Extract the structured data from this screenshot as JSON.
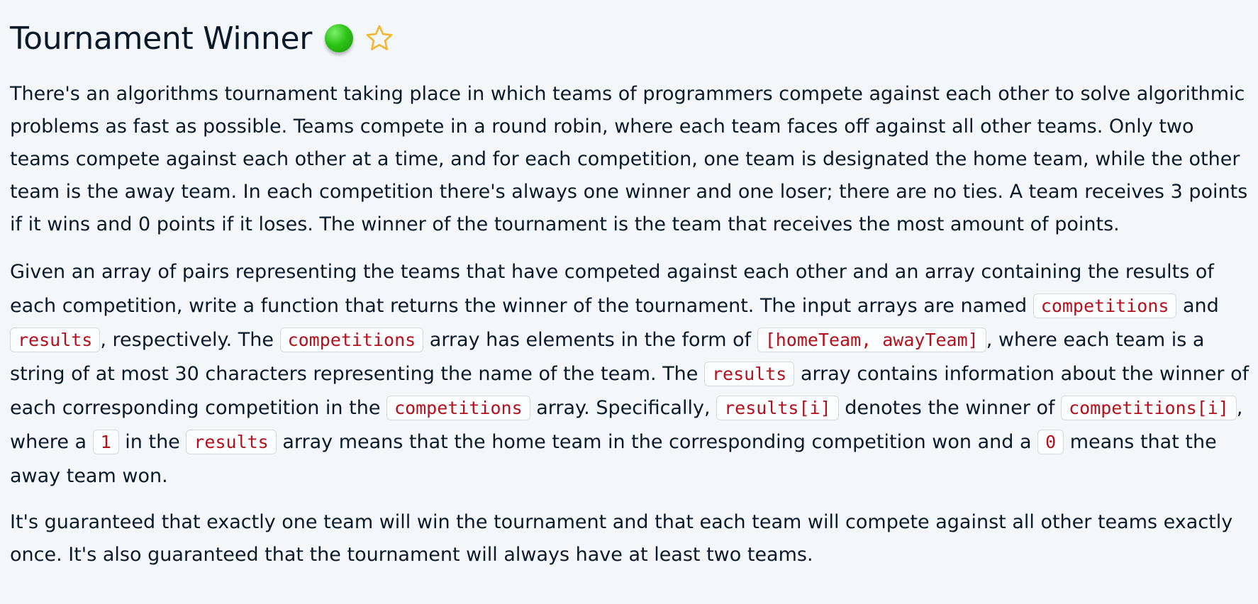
{
  "header": {
    "title": "Tournament Winner",
    "difficulty_color": "#2ec417",
    "favorite_icon": "star-outline-icon",
    "star_color": "#f5b631"
  },
  "paragraphs": {
    "p1": "There's an algorithms tournament taking place in which teams of programmers compete against each other to solve algorithmic problems as fast as possible. Teams compete in a round robin, where each team faces off against all other teams. Only two teams compete against each other at a time, and for each competition, one team is designated the home team, while the other team is the away team. In each competition there's always one winner and one loser; there are no ties. A team receives 3 points if it wins and 0 points if it loses. The winner of the tournament is the team that receives the most amount of points.",
    "p2": {
      "t1": "Given an array of pairs representing the teams that have competed against each other and an array containing the results of each competition, write a function that returns the winner of the tournament. The input arrays are named ",
      "c1": "competitions",
      "t2": " and ",
      "c2": "results",
      "t3": ", respectively. The ",
      "c3": "competitions",
      "t4": " array has elements in the form of ",
      "c4": "[homeTeam, awayTeam]",
      "t5": ", where each team is a string of at most 30 characters representing the name of the team. The ",
      "c5": "results",
      "t6": " array contains information about the winner of each corresponding competition in the ",
      "c6": "competitions",
      "t7": " array. Specifically, ",
      "c7": "results[i]",
      "t8": " denotes the winner of ",
      "c8": "competitions[i]",
      "t9": ", where a ",
      "c9": "1",
      "t10": " in the ",
      "c10": "results",
      "t11": " array means that the home team in the corresponding competition won and a ",
      "c11": "0",
      "t12": " means that the away team won."
    },
    "p3": "It's guaranteed that exactly one team will win the tournament and that each team will compete against all other teams exactly once. It's also guaranteed that the tournament will always have at least two teams."
  }
}
